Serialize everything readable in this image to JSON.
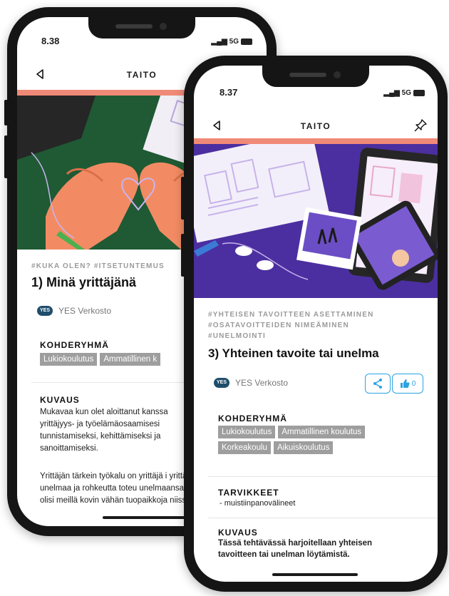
{
  "back_phone": {
    "status_time": "8.38",
    "status_network": "5G",
    "appbar_title": "TAITO",
    "tags": "#KUKA OLEN?  #ITSETUNTEMUS",
    "card_title": "1) Minä yrittäjänä",
    "author": "YES Verkosto",
    "author_logo": "YES",
    "target_group_heading": "KOHDERYHMÄ",
    "target_groups": [
      "Lukiokoulutus",
      "Ammatillinen k"
    ],
    "description_heading": "KUVAUS",
    "description_p1": "Mukavaa kun olet aloittanut kanssa yrittäjyys- ja työelämäosaamisesi tunnistamiseksi, kehittämiseksi ja sanoittamiseksi.",
    "description_p2": "Yrittäjän tärkein työkalu on yrittäjä i yrittäjän unelmaa ja rohkeutta toteu unelmaansa olisi meillä kovin vähän tuopaikkoja niissä"
  },
  "front_phone": {
    "status_time": "8.37",
    "status_network": "5G",
    "appbar_title": "TAITO",
    "tags": [
      "#YHTEISEN TAVOITTEEN ASETTAMINEN",
      "#OSATAVOITTEIDEN NIMEÄMINEN",
      "#UNELMOINTI"
    ],
    "card_title": "3) Yhteinen tavoite tai unelma",
    "author": "YES Verkosto",
    "author_logo": "YES",
    "like_count": "0",
    "target_group_heading": "KOHDERYHMÄ",
    "target_groups": [
      "Lukiokoulutus",
      "Ammatillinen koulutus",
      "Korkeakoulu",
      "Aikuiskoulutus"
    ],
    "supplies_heading": "TARVIKKEET",
    "supplies_item": "- muistiinpanovälineet",
    "description_heading": "KUVAUS",
    "description": "Tässä tehtävässä harjoitellaan yhteisen tavoitteen tai unelman löytämistä."
  },
  "colors": {
    "accent_red": "#f08a78",
    "chip_gray": "#9e9e9e",
    "share_blue": "#2aa3e0",
    "hero_green": "#1f5a34",
    "hero_purple": "#4b2fa0"
  }
}
